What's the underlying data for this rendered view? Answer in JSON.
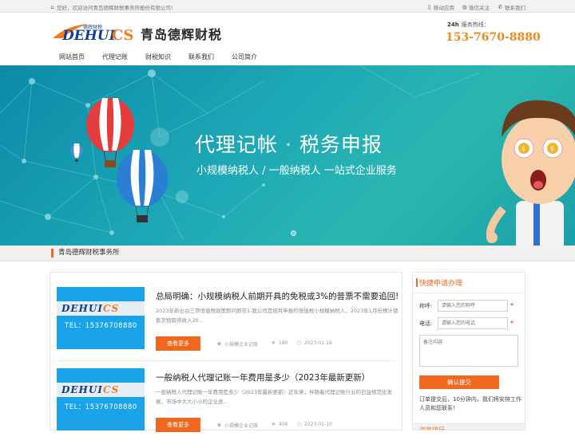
{
  "topbar": {
    "welcome": "您好，欢迎访问青岛德辉财税事务所股份有限公司!",
    "mobile": "移动应用",
    "wechat": "微信关注",
    "contact": "联系我们"
  },
  "header": {
    "logo_text_a": "DEHUI",
    "logo_text_b": "CS",
    "logo_small": "德辉财税",
    "brand": "青岛德辉财税",
    "hotline_label": "服务热线：",
    "hotline_badge": "24h",
    "phone": "153-7670-8880"
  },
  "nav": [
    "网站首页",
    "代理记账",
    "财税知识",
    "联系我们",
    "公司简介"
  ],
  "banner": {
    "title": "代理记帐 · 税务申报",
    "subtitle": "小规模纳税人 / 一般纳税人   一站式企业服务"
  },
  "section": {
    "title": "青岛德辉财税事务所"
  },
  "articles": [
    {
      "title": "总局明确：小规模纳税人前期开具的免税或3%的普票不需要追回!",
      "desc": "2023年新出台三项增值税政策即问即答1.我公司是按月申报的增值税小规模纳税人，2023年1月份预计销售货物取得收入20...",
      "button": "查看更多",
      "category": "小规模企业记账",
      "views": "180",
      "date": "2023-01-16",
      "thumb_tel": "TEL：15376708880"
    },
    {
      "title": "一般纳税人代理记账一年费用是多少（2023年最新更新）",
      "desc": "一般纳税人代理记账一年费用是多少（2023年最新更新）近年来，伴随着代理记账行业的日益规范化发展，市场中大大小小的企业逐...",
      "button": "查看更多",
      "category": "小规模企业记账",
      "views": "406",
      "date": "2023-01-10",
      "thumb_tel": "TEL：15376708880"
    }
  ],
  "sidebar": {
    "heading": "快捷申请办理",
    "name_label": "称呼:",
    "name_placeholder": "请输入您的称呼",
    "phone_label": "电话:",
    "phone_placeholder": "请输入您的电话",
    "note_placeholder": "备注内容",
    "submit": "确认提交",
    "note": "订单提交后，10分钟内，我们将安排工作人员和您联系！",
    "heading2": "浏览排行"
  },
  "colors": {
    "accent": "#f0681d",
    "banner": "#1fa9b6",
    "phone": "#f08a1c"
  }
}
